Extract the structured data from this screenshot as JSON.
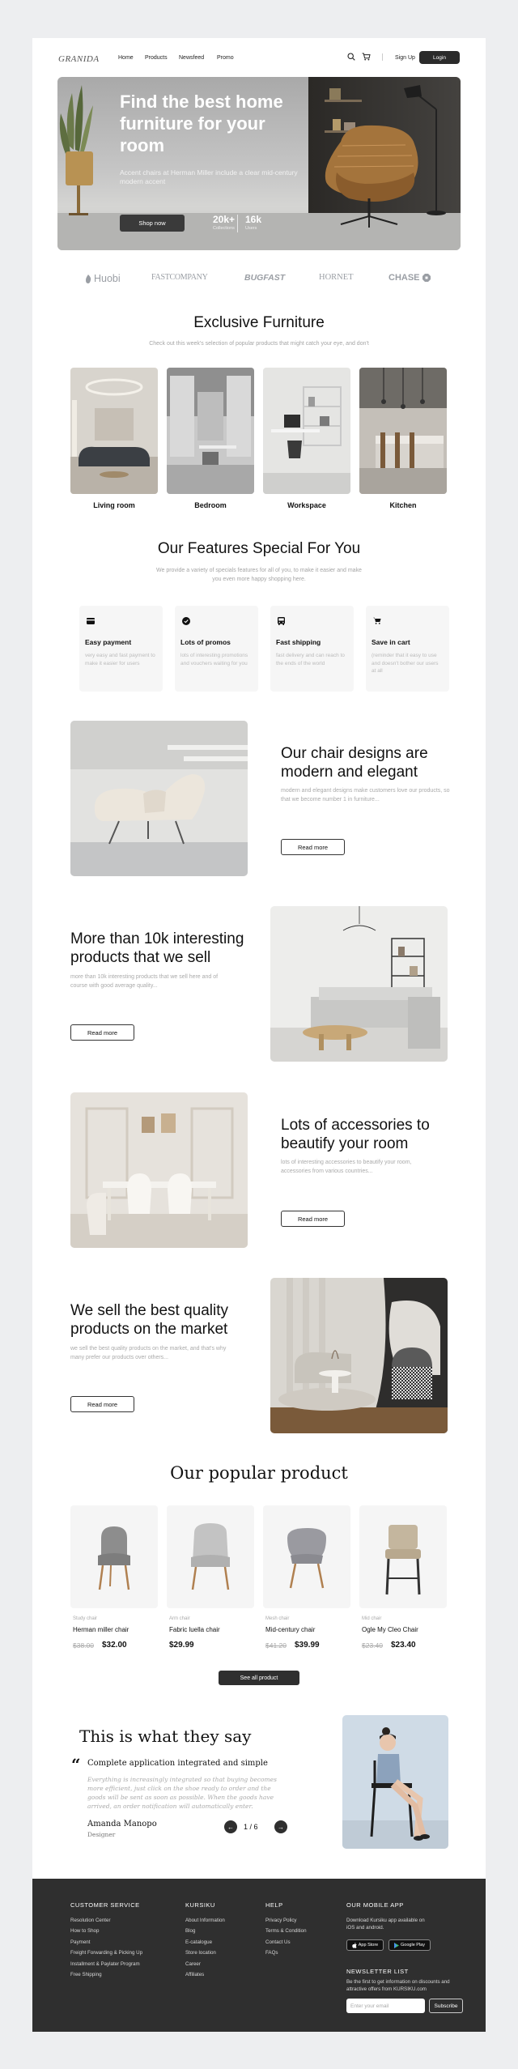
{
  "nav": {
    "logo": "GRANIDA",
    "links": [
      "Home",
      "Products",
      "Newsfeed",
      "Promo"
    ],
    "signup": "Sign Up",
    "login": "Login"
  },
  "hero": {
    "title": "Find the best home furniture for your room",
    "subtitle": "Accent chairs at Herman Miller include a clear mid-century modern accent",
    "cta": "Shop now",
    "stats": [
      {
        "value": "20k+",
        "label": "Collections"
      },
      {
        "value": "16k",
        "label": "Users"
      }
    ]
  },
  "brands": [
    "Huobi",
    "FASTCOMPANY",
    "BUGFAST",
    "HORNET",
    "CHASE"
  ],
  "exclusive": {
    "title": "Exclusive Furniture",
    "subtitle": "Check out this week's selection of popular products that might catch your eye, and don't",
    "rooms": [
      "Living room",
      "Bedroom",
      "Workspace",
      "Kitchen"
    ]
  },
  "features": {
    "title": "Our Features Special For You",
    "subtitle": "We provide a variety of specials features for all of you, to make it easier and make you even more happy shopping here.",
    "items": [
      {
        "title": "Easy payment",
        "desc": "very easy and fast payment to make it easier for users"
      },
      {
        "title": "Lots of promos",
        "desc": "lots of interesting promotions and vouchers waiting for you"
      },
      {
        "title": "Fast shipping",
        "desc": "fast delivery and can reach to the ends of the world"
      },
      {
        "title": "Save in cart",
        "desc": "(reminder that it easy to use and doesn't bother our users at all"
      }
    ]
  },
  "promos": [
    {
      "title": "Our chair designs are modern and elegant",
      "desc": "modern and elegant designs make customers love our products, so that we become number 1 in furniture...",
      "cta": "Read more"
    },
    {
      "title": "More than 10k interesting products that we sell",
      "desc": "more than 10k interesting products that we sell here and of course with good average quality...",
      "cta": "Read more"
    },
    {
      "title": "Lots of accessories to beautify your room",
      "desc": "lots of interesting accessories to beautify your room, accessories from various countries...",
      "cta": "Read more"
    },
    {
      "title": "We sell the best quality products on the market",
      "desc": "we sell the best quality products on the market, and that's why many prefer our products over others...",
      "cta": "Read more"
    }
  ],
  "popular": {
    "title": "Our popular product",
    "products": [
      {
        "category": "Study chair",
        "name": "Herman miller chair",
        "old_price": "$38.00",
        "price": "$32.00"
      },
      {
        "category": "Arm chair",
        "name": "Fabric luella chair",
        "old_price": "",
        "price": "$29.99"
      },
      {
        "category": "Mesh chair",
        "name": "Mid-century chair",
        "old_price": "$41.20",
        "price": "$39.99"
      },
      {
        "category": "Mid chair",
        "name": "Ogle My Cleo Chair",
        "old_price": "$23.40",
        "price": "$23.40"
      }
    ],
    "see_all": "See all product"
  },
  "testimonial": {
    "title": "This is what they say",
    "quote_head": "Complete application integrated and simple",
    "quote_body": "Everything is increasingly integrated so that buying becomes more efficient, just click on the shoe ready to order and the goods will be sent as soon as possible. When the goods have arrived, an order notification will automatically enter.",
    "name": "Amanda Manopo",
    "role": "Designer",
    "pager": "1 / 6"
  },
  "footer": {
    "customer_service": {
      "title": "CUSTOMER SERVICE",
      "links": [
        "Resolution Center",
        "How to Shop",
        "Payment",
        "Freight Forwarding & Picking Up",
        "Installment & Paylater Program",
        "Free Shipping"
      ]
    },
    "kursiku": {
      "title": "KURSIKU",
      "links": [
        "About Information",
        "Blog",
        "E-catalogue",
        "Store location",
        "Career",
        "Affiliates"
      ]
    },
    "help": {
      "title": "HELP",
      "links": [
        "Privacy Policy",
        "Terms & Condition",
        "Contact Us",
        "FAQs"
      ]
    },
    "mobile": {
      "title": "OUR MOBILE APP",
      "text": "Download Kursiku app available on iOS and android.",
      "app_store": "App Store",
      "google_play": "Google Play"
    },
    "newsletter": {
      "title": "NEWSLETTER LIST",
      "text": "Be the first to get information on discounts and attractive offers from KURSIKU.com",
      "placeholder": "Enter your email",
      "button": "Subscribe"
    }
  }
}
